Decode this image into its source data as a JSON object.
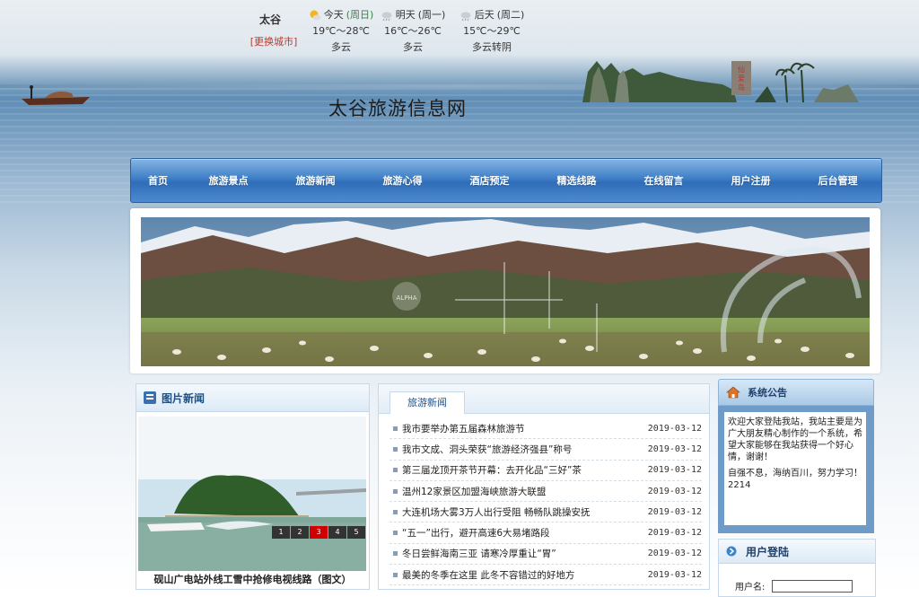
{
  "weather": {
    "city": "太谷",
    "change_city": "[更换城市]",
    "days": [
      {
        "label": "今天",
        "weekday": "(周日)",
        "temp": "19℃～28℃",
        "desc": "多云",
        "icon": "partly-cloudy-icon"
      },
      {
        "label": "明天",
        "weekday": "(周一)",
        "temp": "16℃～26℃",
        "desc": "多云",
        "icon": "cloud-icon"
      },
      {
        "label": "后天",
        "weekday": "(周二)",
        "temp": "15℃～29℃",
        "desc": "多云转阴",
        "icon": "cloud-icon"
      }
    ]
  },
  "site": {
    "title": "太谷旅游信息网"
  },
  "nav": {
    "items": [
      "首页",
      "旅游景点",
      "旅游新闻",
      "旅游心得",
      "酒店预定",
      "精选线路",
      "在线留言",
      "用户注册",
      "后台管理"
    ]
  },
  "banner": {
    "watermark": "ALPHA"
  },
  "pic_news": {
    "title": "图片新闻",
    "caption": "砚山广电站外线工雪中抢修电视线路（图文）",
    "pager": [
      "1",
      "2",
      "3",
      "4",
      "5"
    ],
    "active_page": "3"
  },
  "travel_news": {
    "tab": "旅游新闻",
    "items": [
      {
        "title": "我市要举办第五届森林旅游节",
        "date": "2019-03-12"
      },
      {
        "title": "我市文成、洞头荣获“旅游经济强县”称号",
        "date": "2019-03-12"
      },
      {
        "title": "第三届龙顶开茶节开幕：去开化品“三好”茶",
        "date": "2019-03-12"
      },
      {
        "title": "温州12家景区加盟海峡旅游大联盟",
        "date": "2019-03-12"
      },
      {
        "title": "大连机场大雾3万人出行受阻 畅畅队跳操安抚",
        "date": "2019-03-12"
      },
      {
        "title": "“五一”出行，避开高速6大易堵路段",
        "date": "2019-03-12"
      },
      {
        "title": "冬日尝鲜海南三亚 请寒冷厚重让“胃”",
        "date": "2019-03-12"
      },
      {
        "title": "最美的冬季在这里 此冬不容错过的好地方",
        "date": "2019-03-12"
      }
    ]
  },
  "notice": {
    "title": "系统公告",
    "paragraph1": "欢迎大家登陆我站，我站主要是为广大朋友精心制作的一个系统，希望大家能够在我站获得一个好心情，谢谢！",
    "paragraph2": "自强不息，海纳百川，努力学习！2214"
  },
  "login": {
    "title": "用户登陆",
    "username_label": "用户名:",
    "username_value": ""
  },
  "colors": {
    "nav_blue": "#3f7fc7",
    "panel_border": "#c6d8ea",
    "heading_blue": "#1f4f82",
    "change_city_red": "#c0392b",
    "weekday_green": "#2e8b3a",
    "active_page_red": "#d10000"
  }
}
